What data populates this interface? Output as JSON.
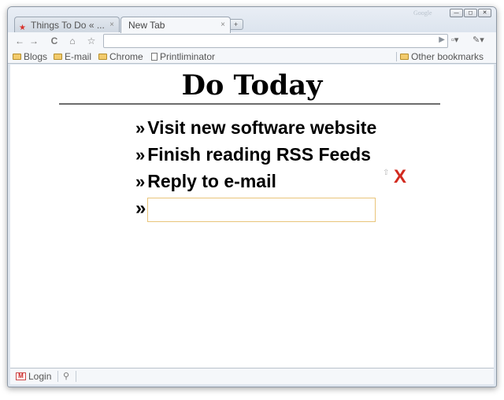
{
  "browser": {
    "google_mark": "Google",
    "window_buttons": {
      "minimize": "—",
      "maximize": "◻",
      "close": "✕"
    },
    "tabs": [
      {
        "label": "Things To Do « ...",
        "active": false,
        "close": "×"
      },
      {
        "label": "New Tab",
        "active": true,
        "close": "×"
      }
    ],
    "new_tab_symbol": "+",
    "toolbar": {
      "back": "←",
      "forward": "→",
      "reload": "C",
      "home": "⌂",
      "star": "☆",
      "go": "▶",
      "page_menu": "▫▾",
      "wrench_menu": "✎▾"
    },
    "bookmarks": [
      {
        "label": "Blogs",
        "icon": "folder-icon"
      },
      {
        "label": "E-mail",
        "icon": "folder-icon"
      },
      {
        "label": "Chrome",
        "icon": "folder-icon"
      },
      {
        "label": "Printliminator",
        "icon": "page-icon"
      }
    ],
    "other_bookmarks": "Other bookmarks"
  },
  "page": {
    "title": "Do Today",
    "bullet": "»",
    "items": [
      {
        "text": "Visit new software website"
      },
      {
        "text": "Finish reading RSS Feeds"
      },
      {
        "text": "Reply to e-mail"
      }
    ],
    "move_symbol": "⇧",
    "delete_symbol": "X",
    "new_item_value": ""
  },
  "statusbar": {
    "gmail_icon_letter": "M",
    "login": "Login",
    "tool_symbol": "⚲"
  },
  "colors": {
    "delete": "#d22b20",
    "input_border": "#e9c57a",
    "folder": "#f2cb6c"
  }
}
